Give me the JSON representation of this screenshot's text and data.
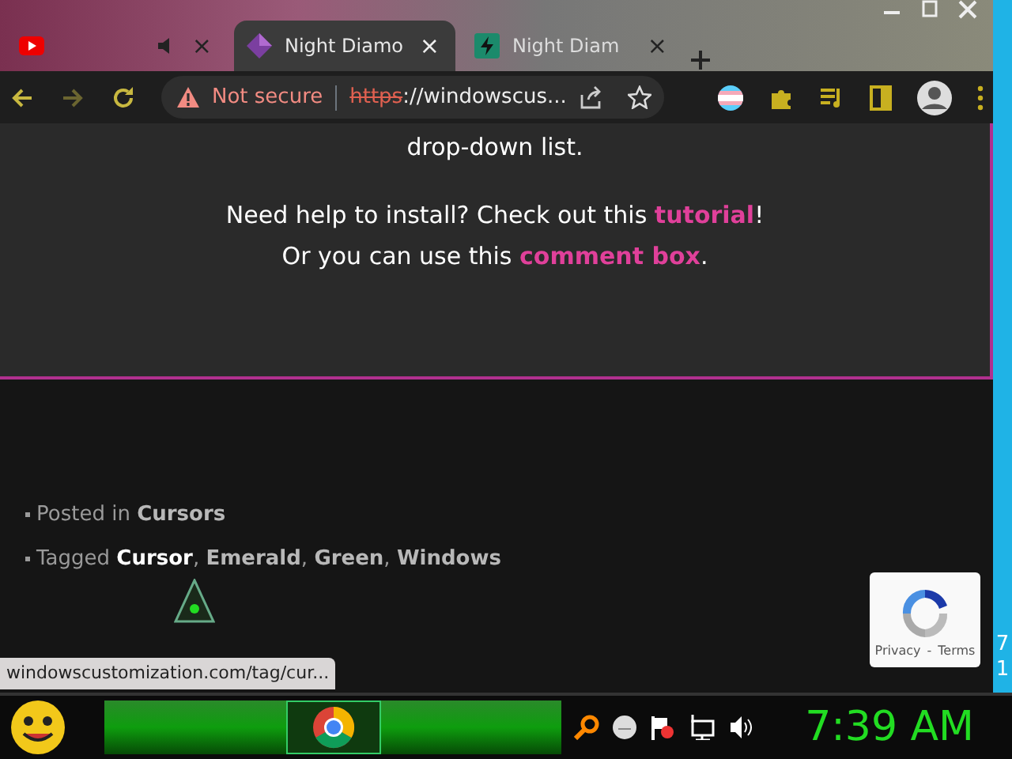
{
  "tabs": [
    {
      "kind": "video",
      "audio": true,
      "close": "×",
      "selected": false
    },
    {
      "title": "Night Diamo",
      "kind": "diamond",
      "audio": false,
      "close": "×",
      "selected": true
    },
    {
      "title": "Night Diam",
      "kind": "bolt",
      "audio": false,
      "close": "×",
      "selected": false
    }
  ],
  "address_bar": {
    "security": "Not secure",
    "scheme": "https",
    "rest": "://windowscus...",
    "bookmarked": false
  },
  "card": {
    "intro": "drop-down list.",
    "lines": [
      {
        "before": "Need help to install? Check out this ",
        "link": "tutorial",
        "after": "!"
      },
      {
        "before": "Or you can use this ",
        "link": "comment box",
        "after": "."
      }
    ]
  },
  "meta": [
    {
      "label": "Posted in",
      "links": [
        {
          "text": "Cursors",
          "hovered": false
        }
      ]
    },
    {
      "label": "Tagged",
      "links": [
        {
          "text": "Cursor",
          "hovered": true,
          "after": ","
        },
        {
          "text": "Emerald",
          "hovered": false,
          "after": ","
        },
        {
          "text": "Green",
          "hovered": false,
          "after": ","
        },
        {
          "text": "Windows",
          "hovered": false
        }
      ]
    }
  ],
  "status_url": "windowscustomization.com/tag/cur...",
  "recaptcha": {
    "privacy": "Privacy",
    "separator": "-",
    "terms": "Terms"
  },
  "side_strip": [
    "7",
    "1"
  ],
  "taskbar": {
    "clock": "7:39 AM"
  }
}
